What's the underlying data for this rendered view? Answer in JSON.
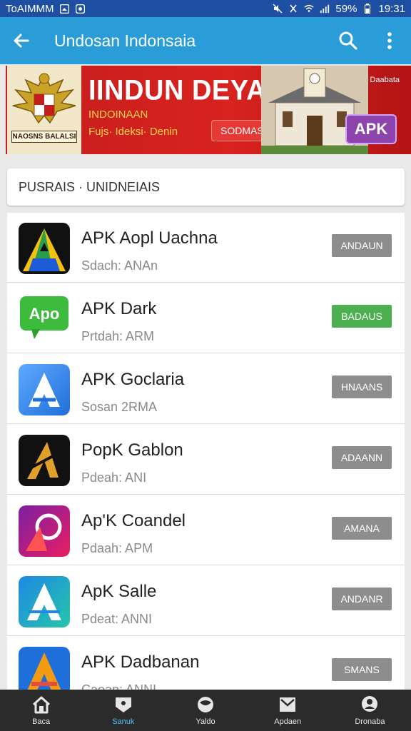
{
  "status_bar": {
    "carrier": "ToAIMMM",
    "battery": "59%",
    "time": "19:31"
  },
  "app_bar": {
    "title": "Undosan Indonsaia"
  },
  "banner": {
    "headline": "IINDUN DEYAN",
    "sub1": "INDOINAAN",
    "sub2": "Fujs· Ideksi· Denin",
    "badge": "SODMASIAGOK",
    "corner_text": "Daabata",
    "apk_label": "APK",
    "emblem_text": "NAOSNS BALALSI"
  },
  "section": {
    "title": "PUSRAIS · UNIDNEIAIS"
  },
  "apps": [
    {
      "name": "APK Aopl Uachna",
      "meta": "Sdach: ANAn",
      "action": "ANDAUN",
      "icon": "triangle-a-icon",
      "colors": [
        "#111111",
        "#f4c20d",
        "#2a9d4f",
        "#1e5bd6"
      ],
      "action_color": "gray"
    },
    {
      "name": "APK Dark",
      "meta": "Prtdah: ARM",
      "action": "BADAUS",
      "icon": "apo-chat-icon",
      "colors": [
        "#3dbb3d",
        "#2ea02e"
      ],
      "action_color": "green"
    },
    {
      "name": "APK Goclaria",
      "meta": "Sosan 2RMA",
      "action": "HNAANS",
      "icon": "blue-a-icon",
      "colors": [
        "#1e6fd9",
        "#5fa9ff"
      ],
      "action_color": "gray"
    },
    {
      "name": "PopK Gablon",
      "meta": "Pdeah: ANI",
      "action": "ADAANN",
      "icon": "gold-a-icon",
      "colors": [
        "#111111",
        "#e0a02a"
      ],
      "action_color": "gray"
    },
    {
      "name": "Ap'K Coandel",
      "meta": "Pdaah: APM",
      "action": "AMANA",
      "icon": "purple-swirl-icon",
      "colors": [
        "#7b1fa2",
        "#e91e63"
      ],
      "action_color": "gray"
    },
    {
      "name": "ApK Salle",
      "meta": "Pdeat: ANNI",
      "action": "ANDANR",
      "icon": "teal-a-icon",
      "colors": [
        "#1e88e5",
        "#26c6a9"
      ],
      "action_color": "gray"
    },
    {
      "name": "APK Dadbanan",
      "meta": "Caoan: ANNI",
      "action": "SMANS",
      "icon": "orange-a-icon",
      "colors": [
        "#1e6fd9",
        "#f39c12",
        "#e74c3c"
      ],
      "action_color": "gray"
    }
  ],
  "bottom_nav": [
    {
      "label": "Baca",
      "icon": "home-icon",
      "active": false
    },
    {
      "label": "Sanuk",
      "icon": "tag-icon",
      "active": true
    },
    {
      "label": "Yaldo",
      "icon": "globe-icon",
      "active": false
    },
    {
      "label": "Apdaen",
      "icon": "mail-icon",
      "active": false
    },
    {
      "label": "Dronaba",
      "icon": "user-icon",
      "active": false
    }
  ]
}
